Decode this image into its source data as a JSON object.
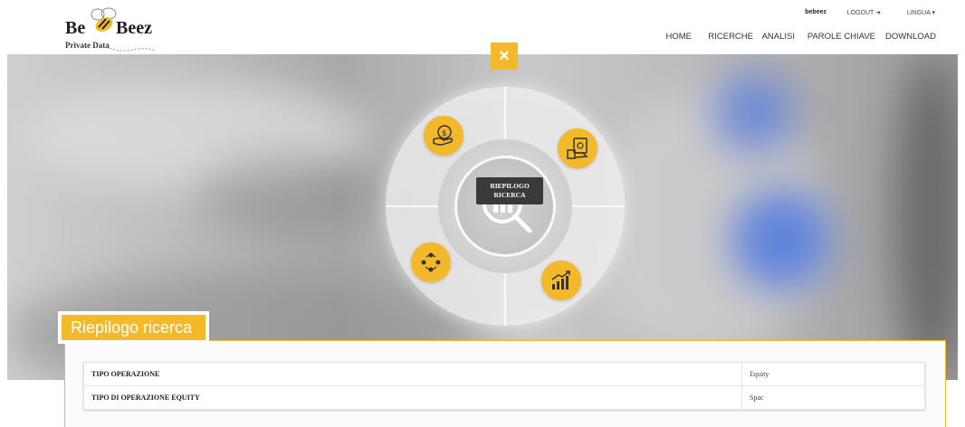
{
  "header": {
    "logo": {
      "word_left": "Be",
      "word_right": "Beez",
      "subtitle": "Private Data"
    },
    "user": {
      "name": "bebeez",
      "logout": "LOGOUT",
      "language": "LINGUA"
    },
    "nav": [
      {
        "label": "HOME"
      },
      {
        "label": "RICERCHE"
      },
      {
        "label": "ANALISI"
      },
      {
        "label": "PAROLE CHIAVE"
      },
      {
        "label": "DOWNLOAD"
      }
    ]
  },
  "radial_menu": {
    "close_label": "×",
    "center_tooltip_line1": "RIEPILOGO",
    "center_tooltip_line2": "RICERCA",
    "actions": [
      {
        "icon": "handshake-coin-icon"
      },
      {
        "icon": "money-hand-icon"
      },
      {
        "icon": "people-network-icon"
      },
      {
        "icon": "growth-chart-icon"
      }
    ]
  },
  "summary": {
    "title": "Riepilogo ricerca",
    "rows": [
      {
        "key": "TIPO OPERAZIONE",
        "value": "Equity"
      },
      {
        "key": "TIPO DI OPERAZIONE EQUITY",
        "value": "Spac"
      }
    ]
  },
  "colors": {
    "accent": "#f4b92a",
    "dark": "#3a3a3a"
  }
}
